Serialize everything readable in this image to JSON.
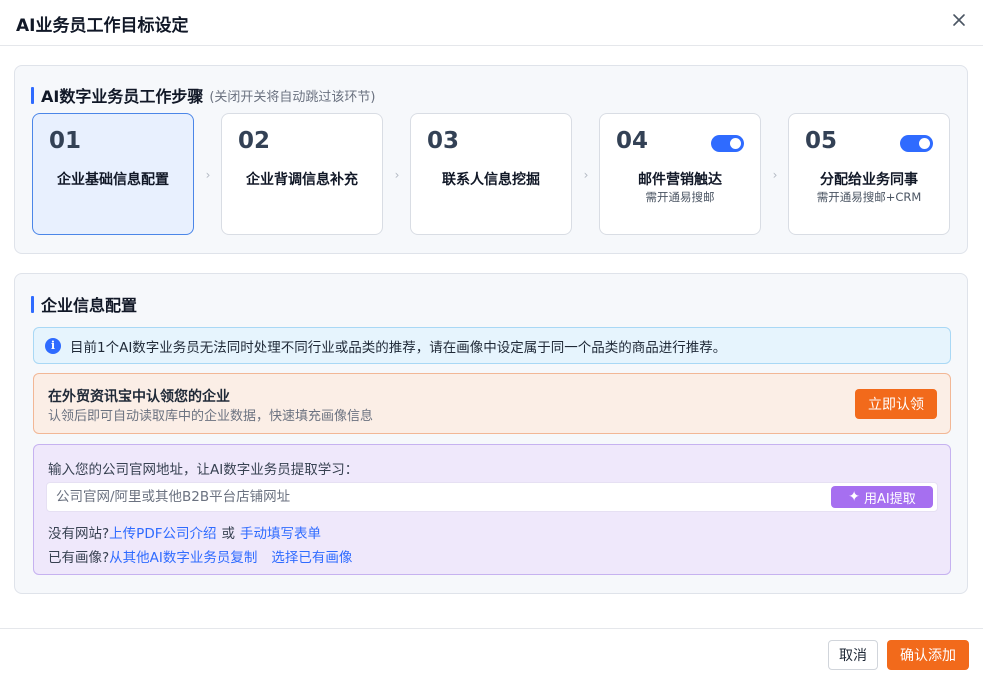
{
  "dialog": {
    "title": "AI业务员工作目标设定",
    "close_icon": "close-icon"
  },
  "steps_section": {
    "title": "AI数字业务员工作步骤",
    "hint": "(关闭开关将自动跳过该环节)",
    "steps": [
      {
        "num": "01",
        "name": "企业基础信息配置",
        "sub": "",
        "active": true,
        "toggle": false
      },
      {
        "num": "02",
        "name": "企业背调信息补充",
        "sub": "",
        "active": false,
        "toggle": false
      },
      {
        "num": "03",
        "name": "联系人信息挖掘",
        "sub": "",
        "active": false,
        "toggle": false
      },
      {
        "num": "04",
        "name": "邮件营销触达",
        "sub": "需开通易搜邮",
        "active": false,
        "toggle": true,
        "toggle_on": true
      },
      {
        "num": "05",
        "name": "分配给业务同事",
        "sub": "需开通易搜邮+CRM",
        "active": false,
        "toggle": true,
        "toggle_on": true
      }
    ],
    "arrow_glyph": "›"
  },
  "config_section": {
    "title": "企业信息配置",
    "info_icon": "info-icon",
    "info_icon_glyph": "i",
    "info_text": "目前1个AI数字业务员无法同时处理不同行业或品类的推荐，请在画像中设定属于同一个品类的商品进行推荐。",
    "claim": {
      "title": "在外贸资讯宝中认领您的企业",
      "desc": "认领后即可自动读取库中的企业数据，快速填充画像信息",
      "button": "立即认领"
    },
    "learn": {
      "prompt": "输入您的公司官网地址，让AI数字业务员提取学习：",
      "input_value": "",
      "input_placeholder": "公司官网/阿里或其他B2B平台店铺网址",
      "ai_button": "用AI提取",
      "ai_icon": "sparkle-icon",
      "ai_icon_glyph": "✦",
      "no_site_label": "没有网站?",
      "upload_pdf_link": "上传PDF公司介绍",
      "or_label": "或",
      "manual_fill_link": "手动填写表单",
      "has_profile_label": "已有画像?",
      "copy_link": "从其他AI数字业务员复制",
      "select_link": "选择已有画像"
    }
  },
  "footer": {
    "cancel": "取消",
    "confirm": "确认添加"
  },
  "colors": {
    "accent_blue": "#2f6bff",
    "accent_orange": "#f26a1b",
    "ai_purple": "#a66ff0"
  }
}
